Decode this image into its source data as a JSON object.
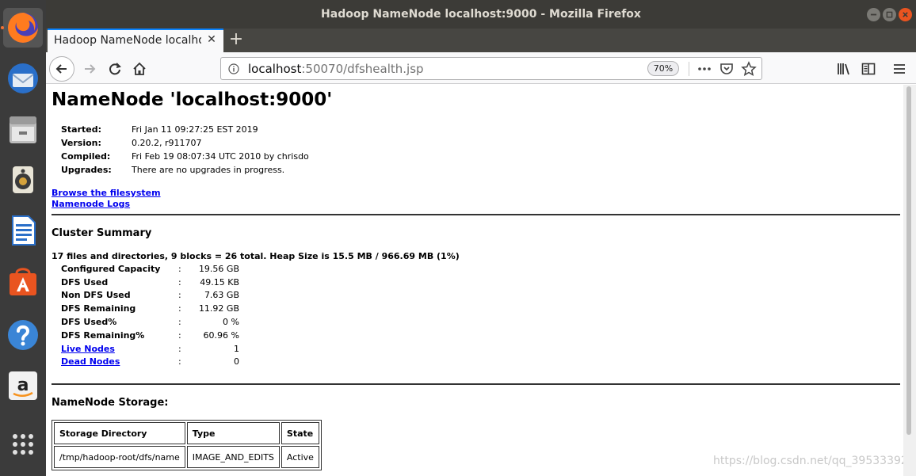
{
  "window": {
    "title": "Hadoop NameNode localhost:9000 - Mozilla Firefox"
  },
  "tab": {
    "label": "Hadoop NameNode localhost:9000"
  },
  "urlbar": {
    "host": "localhost",
    "path": ":50070/dfshealth.jsp",
    "zoom": "70%"
  },
  "page": {
    "heading": "NameNode 'localhost:9000'",
    "info": [
      {
        "label": "Started:",
        "value": "Fri Jan 11 09:27:25 EST 2019"
      },
      {
        "label": "Version:",
        "value": "0.20.2, r911707"
      },
      {
        "label": "Compiled:",
        "value": "Fri Feb 19 08:07:34 UTC 2010 by chrisdo"
      },
      {
        "label": "Upgrades:",
        "value": "There are no upgrades in progress."
      }
    ],
    "links": {
      "browse": "Browse the filesystem",
      "logs": "Namenode Logs"
    },
    "cluster_summary": {
      "heading": "Cluster Summary",
      "totals": "17 files and directories, 9 blocks = 26 total. Heap Size is 15.5 MB / 966.69 MB (1%)",
      "rows": [
        {
          "label": "Configured Capacity",
          "value": "19.56 GB"
        },
        {
          "label": "DFS Used",
          "value": "49.15 KB"
        },
        {
          "label": "Non DFS Used",
          "value": "7.63 GB"
        },
        {
          "label": "DFS Remaining",
          "value": "11.92 GB"
        },
        {
          "label": "DFS Used%",
          "value": "0 %"
        },
        {
          "label": "DFS Remaining%",
          "value": "60.96 %"
        },
        {
          "label": "Live Nodes",
          "value": "1"
        },
        {
          "label": "Dead Nodes",
          "value": "0"
        }
      ],
      "colon": ":"
    },
    "storage": {
      "heading": "NameNode Storage:",
      "headers": [
        "Storage Directory",
        "Type",
        "State"
      ],
      "row": [
        "/tmp/hadoop-root/dfs/name",
        "IMAGE_AND_EDITS",
        "Active"
      ]
    }
  },
  "watermark": "https://blog.csdn.net/qq_39533392",
  "dock": [
    "firefox-icon",
    "thunderbird-icon",
    "files-icon",
    "rhythmbox-icon",
    "writer-icon",
    "software-icon",
    "help-icon",
    "amazon-icon",
    "apps-grid-icon"
  ]
}
